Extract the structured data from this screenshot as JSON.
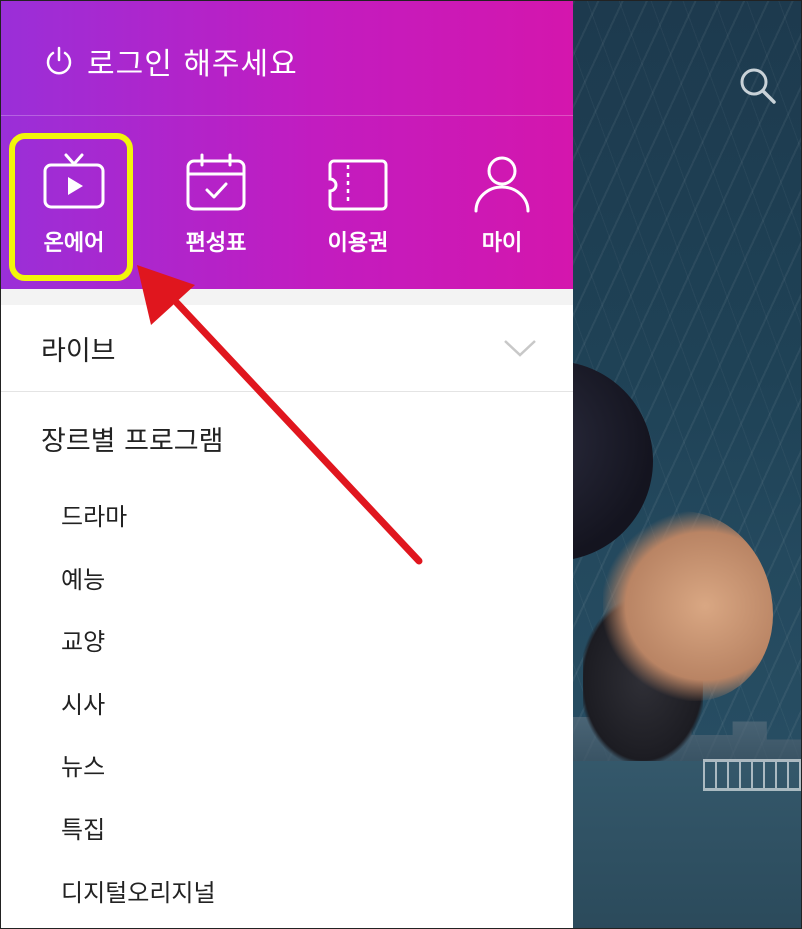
{
  "header": {
    "login_label": "로그인 해주세요"
  },
  "nav": {
    "items": [
      {
        "label": "온에어",
        "icon": "tv-icon"
      },
      {
        "label": "편성표",
        "icon": "calendar-check-icon"
      },
      {
        "label": "이용권",
        "icon": "ticket-icon"
      },
      {
        "label": "마이",
        "icon": "person-icon"
      }
    ]
  },
  "menu": {
    "live_label": "라이브",
    "genre_title": "장르별 프로그램",
    "genres": [
      "드라마",
      "예능",
      "교양",
      "시사",
      "뉴스",
      "특집",
      "디지털오리지널"
    ]
  },
  "colors": {
    "header_gradient_start": "#9a2fd8",
    "header_gradient_end": "#d416ad",
    "highlight": "#f2f50a",
    "arrow": "#e0161e"
  }
}
